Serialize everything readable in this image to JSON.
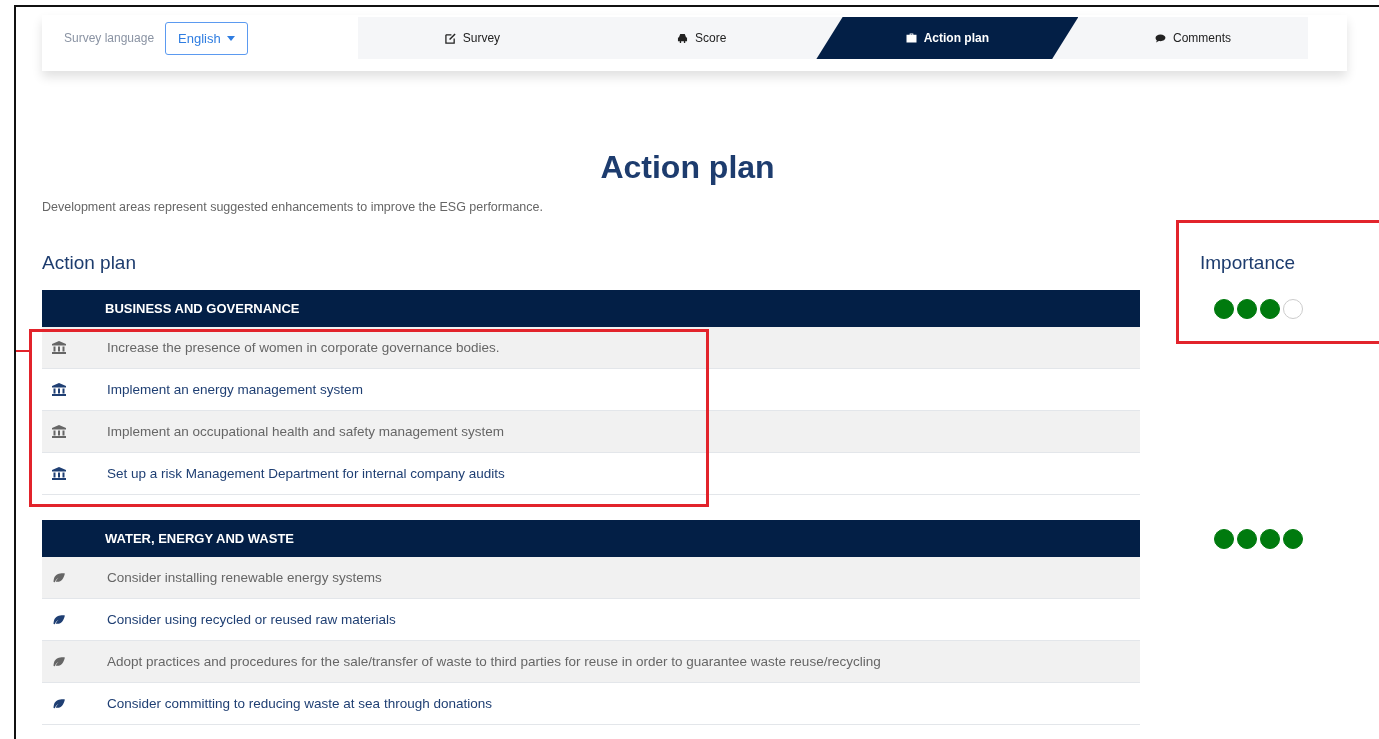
{
  "header": {
    "language_label": "Survey language",
    "language": "English"
  },
  "tabs": [
    {
      "label": "Survey",
      "selected": false
    },
    {
      "label": "Score",
      "selected": false
    },
    {
      "label": "Action plan",
      "selected": true
    },
    {
      "label": "Comments",
      "selected": false
    }
  ],
  "title": "Action plan",
  "subtitle": "Development areas represent suggested enhancements to improve the ESG performance.",
  "section_heading": "Action plan",
  "importance_heading": "Importance",
  "importance_highlighted": true,
  "sections": [
    {
      "title": "BUSINESS AND GOVERNANCE",
      "stars": 3,
      "highlighted": true,
      "items": [
        "Increase the presence of women in corporate governance bodies.",
        "Implement an energy management system",
        "Implement an occupational health and safety management system",
        "Set up a risk Management Department for internal company audits"
      ]
    },
    {
      "title": "WATER, ENERGY AND WASTE",
      "stars": 4,
      "highlighted": false,
      "items": [
        "Consider installing renewable energy systems",
        "Consider using recycled or reused raw materials",
        "Adopt practices and procedures for the sale/transfer of waste to third parties for reuse in order to guarantee waste reuse/recycling",
        "Consider committing to reducing waste at sea through donations"
      ]
    }
  ]
}
